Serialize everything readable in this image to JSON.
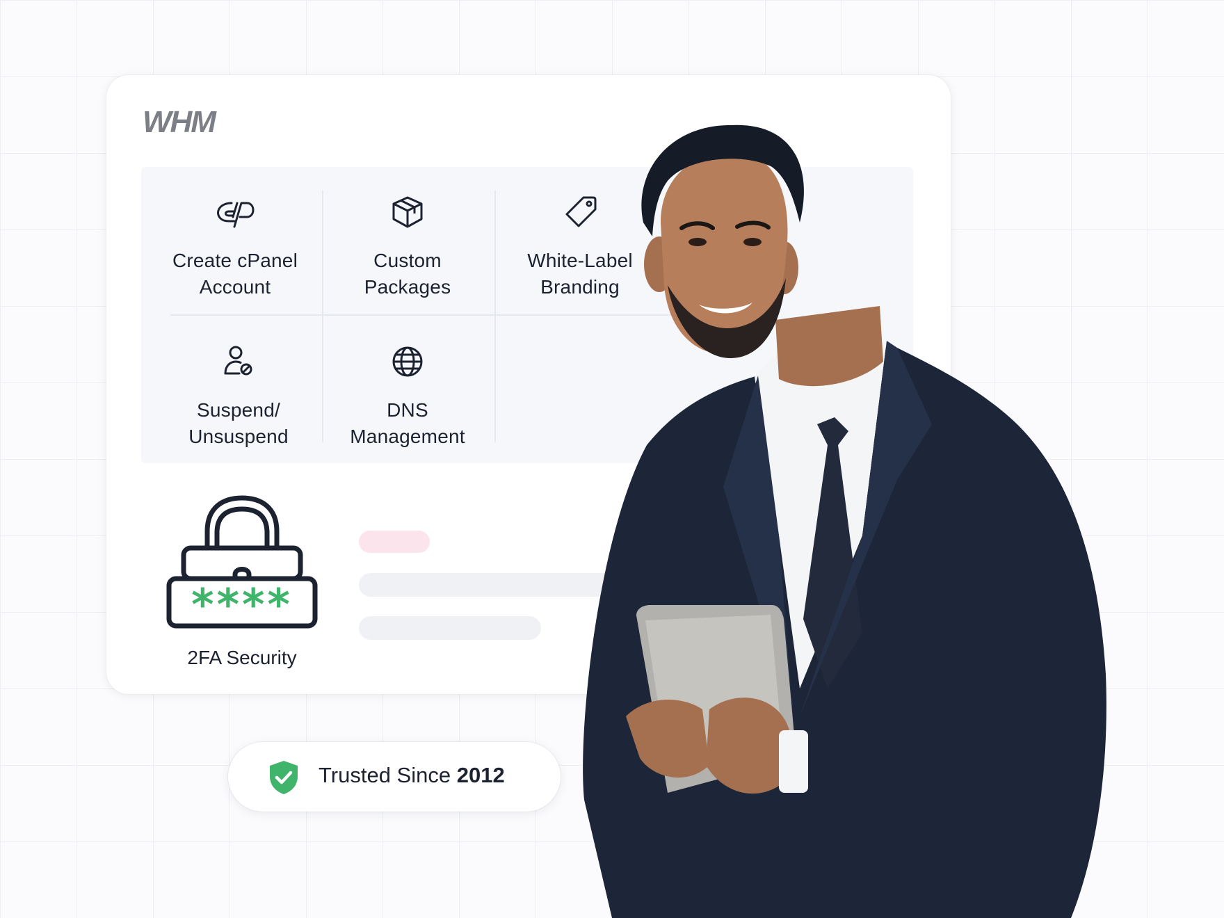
{
  "brand": {
    "logo_text": "WHM"
  },
  "features": [
    {
      "label": "Create cPanel\nAccount",
      "icon": "cpanel-icon"
    },
    {
      "label": "Custom\nPackages",
      "icon": "package-icon"
    },
    {
      "label": "White-Label\nBranding",
      "icon": "tag-icon"
    },
    {
      "label": "Suspend/\nUnsuspend",
      "icon": "user-block-icon"
    },
    {
      "label": "DNS\nManagement",
      "icon": "globe-icon"
    }
  ],
  "security": {
    "label": "2FA Security",
    "password_mask": "****",
    "icon": "padlock-password-icon"
  },
  "badge": {
    "text_prefix": "Trusted Since ",
    "year": "2012",
    "icon": "shield-check-icon"
  },
  "colors": {
    "accent_green": "#3fb46a",
    "text_dark": "#1d2230",
    "suit_navy": "#1c2638",
    "skeleton_pink": "#fbe4ec",
    "skeleton_gray": "#f0f1f5",
    "logo_gray": "#7d7f86"
  }
}
